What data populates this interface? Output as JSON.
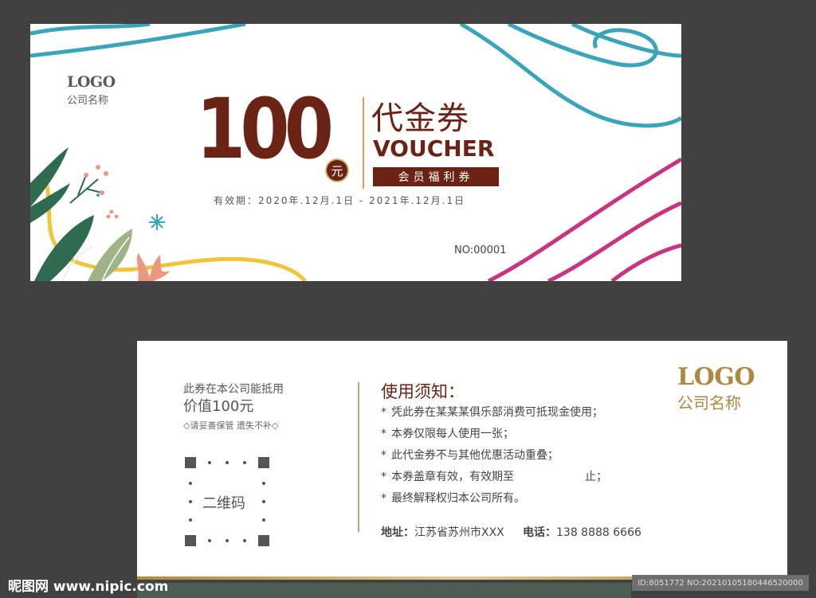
{
  "front": {
    "logo_en": "LOGO",
    "logo_cn": "公司名称",
    "amount": "100",
    "amount_unit": "元",
    "title_cn": "代金券",
    "title_en": "VOUCHER",
    "badge": "会员福利券",
    "validity": "有效期：2020年.12月.1日 - 2021年.12月.1日",
    "serial": "NO:00001",
    "colors": {
      "brand": "#6b2316",
      "gold": "#c9a35a",
      "teal": "#3aa5b8",
      "magenta": "#c8347f",
      "yellow": "#f0c53a"
    }
  },
  "back": {
    "line1": "此券在本公司能抵用",
    "line2": "价值100元",
    "line3": "◇请妥善保管 遗失不补◇",
    "qr_label": "二维码",
    "rules_title": "使用须知：",
    "rules": [
      "凭此券在某某某俱乐部消费可抵现金使用；",
      "本券仅限每人使用一张；",
      "此代金券不与其他优惠活动重叠；",
      "本券盖章有效，有效期至                    止；",
      "最终解释权归本公司所有。"
    ],
    "address_label": "地址：",
    "address": "江苏省苏州市XXX",
    "phone_label": "电话：",
    "phone": "138 8888 6666",
    "logo_en": "LOGO",
    "logo_cn": "公司名称"
  },
  "watermark": {
    "left": "昵图网 www.nipic.com",
    "right": "ID:8051772 NO:20210105180446520000"
  }
}
